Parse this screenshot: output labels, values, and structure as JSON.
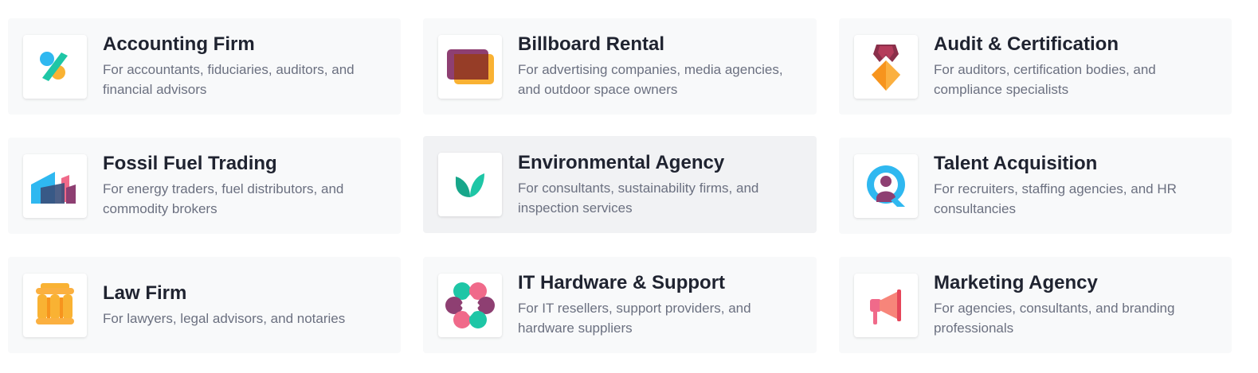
{
  "apps": [
    {
      "title": "Accounting Firm",
      "description": "For accountants, fiduciaries, auditors, and financial advisors",
      "icon": "accounting-icon"
    },
    {
      "title": "Billboard Rental",
      "description": "For advertising companies, media agencies, and outdoor space owners",
      "icon": "billboard-icon"
    },
    {
      "title": "Audit & Certification",
      "description": "For auditors, certification bodies, and compliance specialists",
      "icon": "certification-icon"
    },
    {
      "title": "Fossil Fuel Trading",
      "description": "For energy traders, fuel distributors, and commodity brokers",
      "icon": "fossil-fuel-icon"
    },
    {
      "title": "Environmental Agency",
      "description": "For consultants, sustainability firms, and inspection services",
      "icon": "environmental-icon"
    },
    {
      "title": "Talent Acquisition",
      "description": "For recruiters, staffing agencies, and HR consultancies",
      "icon": "talent-icon"
    },
    {
      "title": "Law Firm",
      "description": "For lawyers, legal advisors, and notaries",
      "icon": "law-icon"
    },
    {
      "title": "IT Hardware & Support",
      "description": "For IT resellers, support providers, and hardware suppliers",
      "icon": "it-hardware-icon"
    },
    {
      "title": "Marketing Agency",
      "description": "For agencies, consultants, and branding professionals",
      "icon": "marketing-icon"
    }
  ],
  "colors": {
    "card_bg": "#f8f9fa",
    "card_hover_bg": "#f1f2f4",
    "title": "#1f2330",
    "description": "#6b7080"
  }
}
